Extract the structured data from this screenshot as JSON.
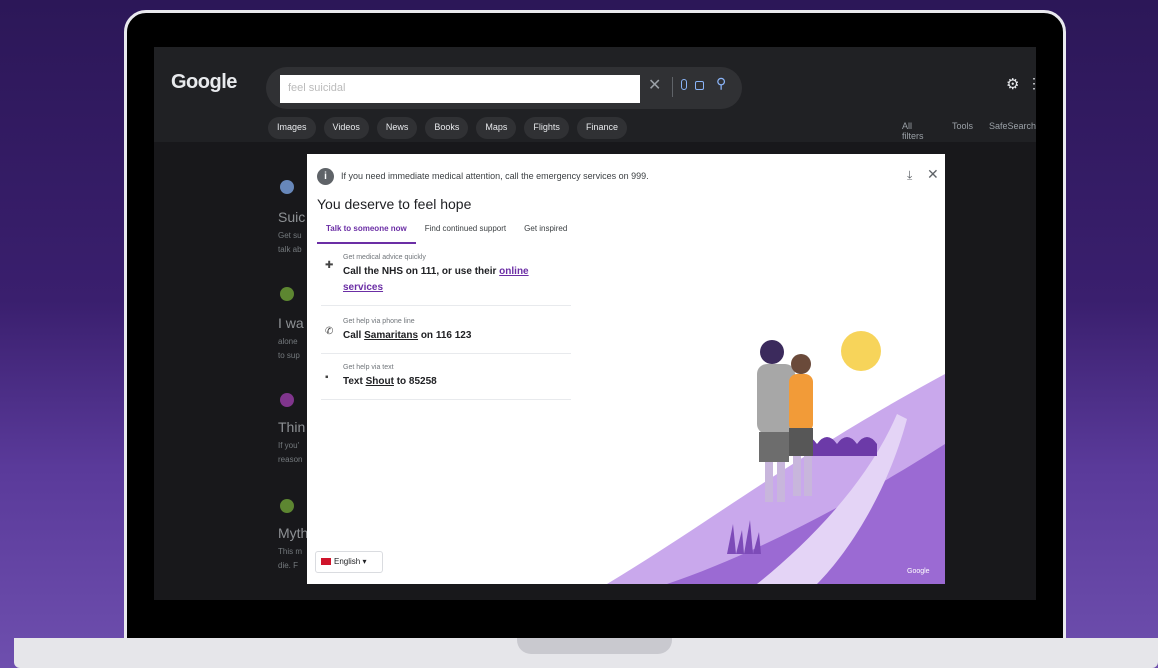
{
  "google": {
    "logo": "Google",
    "search_value": "feel suicidal",
    "tabs": [
      "Images",
      "Videos",
      "News",
      "Books",
      "Maps",
      "Flights",
      "Finance"
    ],
    "right_tools": [
      "All filters",
      "Tools",
      "SafeSearch"
    ],
    "results": [
      {
        "title": "Suic",
        "line1": "Get su",
        "line2": "talk ab"
      },
      {
        "title": "I wa",
        "line1": "alone",
        "line2": "to sup"
      },
      {
        "title": "Thin",
        "line1": "If you'",
        "line2": "reason"
      },
      {
        "title": "Myth",
        "line1": "This m",
        "line2": "die. F"
      }
    ]
  },
  "dialog": {
    "alert": "If you need immediate medical attention, call the emergency services on 999.",
    "title": "You deserve to feel hope",
    "tabs": [
      "Talk to someone now",
      "Find continued support",
      "Get inspired"
    ],
    "options": [
      {
        "small": "Get medical advice quickly",
        "big": "Call the NHS on 111, or use their ",
        "link": "online services"
      },
      {
        "small": "Get help via phone line",
        "big_pre": "Call ",
        "big_u": "Samaritans",
        "big_post": " on 116 123"
      },
      {
        "small": "Get help via text",
        "big_pre": "Text ",
        "big_u": "Shout",
        "big_post": " to 85258"
      }
    ],
    "language": "English",
    "credit": "Google"
  },
  "colors": {
    "accent_purple": "#6b2ea5",
    "hill_purple": "#b48be0",
    "sun_yellow": "#f7d45a"
  }
}
